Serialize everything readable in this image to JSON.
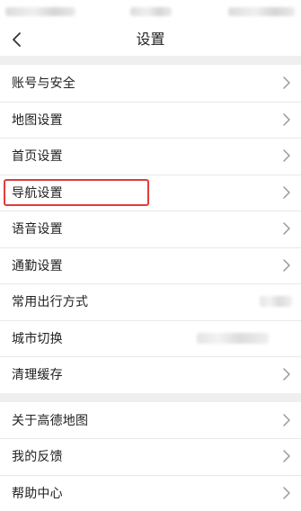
{
  "header": {
    "title": "设置",
    "back_icon": "chevron-left-icon"
  },
  "settings_group_1": [
    {
      "label": "账号与安全"
    },
    {
      "label": "地图设置"
    },
    {
      "label": "首页设置"
    },
    {
      "label": "导航设置",
      "highlighted": true
    },
    {
      "label": "语音设置"
    },
    {
      "label": "通勤设置"
    },
    {
      "label": "常用出行方式"
    },
    {
      "label": "城市切换"
    },
    {
      "label": "清理缓存"
    }
  ],
  "settings_group_2": [
    {
      "label": "关于高德地图"
    },
    {
      "label": "我的反馈"
    },
    {
      "label": "帮助中心"
    }
  ],
  "colors": {
    "highlight": "#e23b3b",
    "section_gap": "#efefef",
    "chevron": "#9a9a9a"
  }
}
